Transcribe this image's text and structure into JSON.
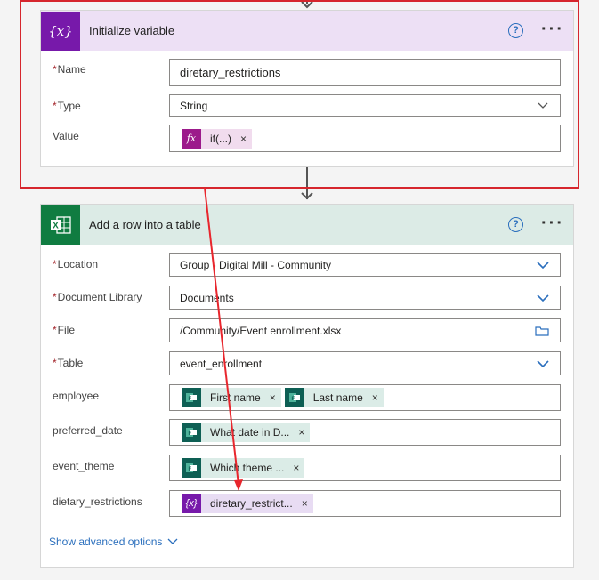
{
  "init_card": {
    "title": "Initialize variable",
    "icon": "variable-icon",
    "accent": "#7719aa",
    "header_bg": "#ede0f5",
    "fields": {
      "name_label": "Name",
      "name_value": "diretary_restrictions",
      "type_label": "Type",
      "type_value": "String",
      "value_label": "Value",
      "value_token": "if(...)"
    }
  },
  "excel_card": {
    "title": "Add a row into a table",
    "icon": "excel-icon",
    "accent": "#107c41",
    "header_bg": "#dcebe6",
    "fields": {
      "location_label": "Location",
      "location_value": "Group - Digital Mill - Community",
      "library_label": "Document Library",
      "library_value": "Documents",
      "file_label": "File",
      "file_value": "/Community/Event enrollment.xlsx",
      "table_label": "Table",
      "table_value": "event_enrollment",
      "employee_label": "employee",
      "employee_token_1": "First name",
      "employee_token_2": "Last name",
      "date_label": "preferred_date",
      "date_token": "What date in D...",
      "theme_label": "event_theme",
      "theme_token": "Which theme ...",
      "diet_label": "dietary_restrictions",
      "diet_token": "diretary_restrict..."
    },
    "advanced_link": "Show advanced options"
  },
  "colors": {
    "highlight": "#d6262d",
    "link": "#2b6fbd",
    "required": "#a4262c"
  }
}
